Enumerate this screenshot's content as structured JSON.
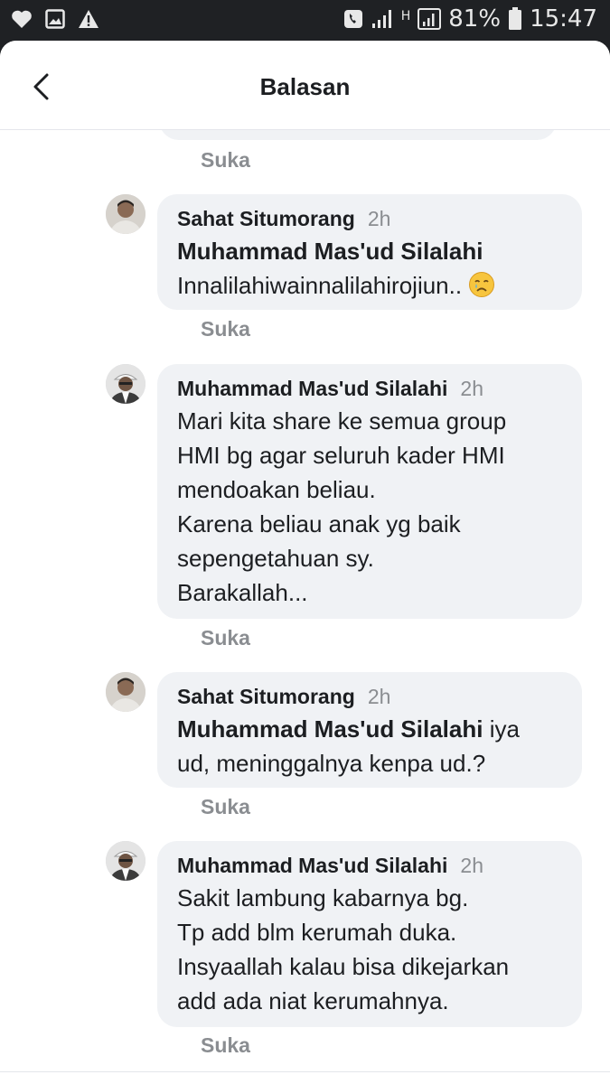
{
  "status_bar": {
    "battery_percent": "81%",
    "time": "15:47",
    "network": "H"
  },
  "header": {
    "title": "Balasan"
  },
  "previous": {
    "like_label": "Suka"
  },
  "comments": [
    {
      "author": "Sahat Situmorang",
      "time": "2h",
      "mention": "Muhammad Mas'ud Silalahi",
      "text": "Innalilahiwainnalilahirojiun..",
      "emoji": "crying-face-icon",
      "like_label": "Suka"
    },
    {
      "author": "Muhammad Mas'ud Silalahi",
      "time": "2h",
      "mention": "",
      "text": "Mari kita share ke semua group\nHMI bg agar seluruh kader HMI\nmendoakan beliau.\nKarena beliau anak yg baik\nsepengetahuan sy.\nBarakallah...",
      "like_label": "Suka"
    },
    {
      "author": "Sahat Situmorang",
      "time": "2h",
      "mention": "Muhammad Mas'ud Silalahi",
      "text": "iya ud, meninggalnya kenpa ud.?",
      "text_line1": "iya",
      "text_line2": "ud, meninggalnya kenpa ud.?",
      "like_label": "Suka"
    },
    {
      "author": "Muhammad Mas'ud Silalahi",
      "time": "2h",
      "mention": "",
      "text": "Sakit lambung kabarnya bg.\nTp add blm kerumah duka.\nInsyaallah kalau bisa dikejarkan\nadd ada niat kerumahnya.",
      "like_label": "Suka"
    }
  ]
}
